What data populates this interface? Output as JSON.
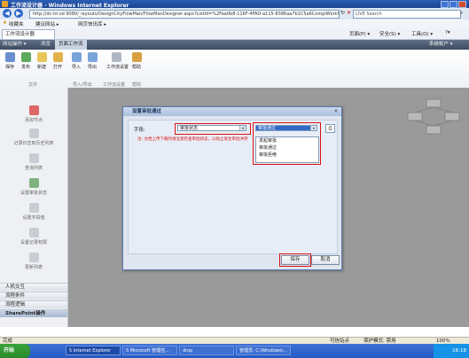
{
  "window": {
    "title": "工作流设计器 - Windows Internet Explorer"
  },
  "address": {
    "url": "http://dc-ht-sd 9080/_layouts/DesignCityFlowMan/FlowManDesigner.aspx?ListId=%2Faa0b8-116F-4FAD-a115-8386aa7b1C5a6ComplWorkflowID=84849700",
    "search": "LIVE Search"
  },
  "favorites": {
    "label": "收藏夹",
    "site1": "建议网站 ▸",
    "site2": "网页快讯库 ▸"
  },
  "tab": {
    "label": "工作流设计器"
  },
  "tab_tools": {
    "page": "页面(P) ▾",
    "safety": "安全(S) ▾",
    "tools": "工具(O) ▾"
  },
  "sharepoint": {
    "site_actions": "网站操作 ▾",
    "browse": "浏览",
    "ribbon_tab": "页面工作流",
    "user": "系统帐户 ▾"
  },
  "ribbon": {
    "buttons": [
      "保存",
      "发布",
      "新建",
      "打开",
      "导入",
      "导出",
      "工作流设置",
      "帮助"
    ],
    "groups": [
      "文件",
      "导入/导出",
      "工作流设置",
      "帮助"
    ]
  },
  "sidebar": {
    "items": [
      "添加节点",
      "记录日志到历史列表",
      "查询列表",
      "设置审批状态",
      "设置字段值",
      "设置记录权限",
      "更新列表"
    ],
    "sections": [
      "人机交互",
      "流程条件",
      "流程逻辑",
      "SharePoint操作"
    ]
  },
  "dialog": {
    "title": "设置审批通过",
    "field_label": "字段:",
    "field_value": "审批状态",
    "value_selected": "审批通过",
    "options": [
      "发起审批",
      "审批通过",
      "审批拒绝"
    ],
    "hint": "注: 文档上传下载时请注意检查审批状态，以防止发生审批冲突",
    "save": "保存",
    "cancel": "取消"
  },
  "statusbar": {
    "left": "完成",
    "zone": "可信站点",
    "protected": "保护模式: 禁用",
    "zoom": "100%"
  },
  "taskbar": {
    "start": "开始",
    "tasks": [
      "5 Internet Explorer",
      "5 Microsoft 管理控...",
      "drop",
      "管理员: C:\\Windows\\..."
    ],
    "clock": "16:18"
  }
}
